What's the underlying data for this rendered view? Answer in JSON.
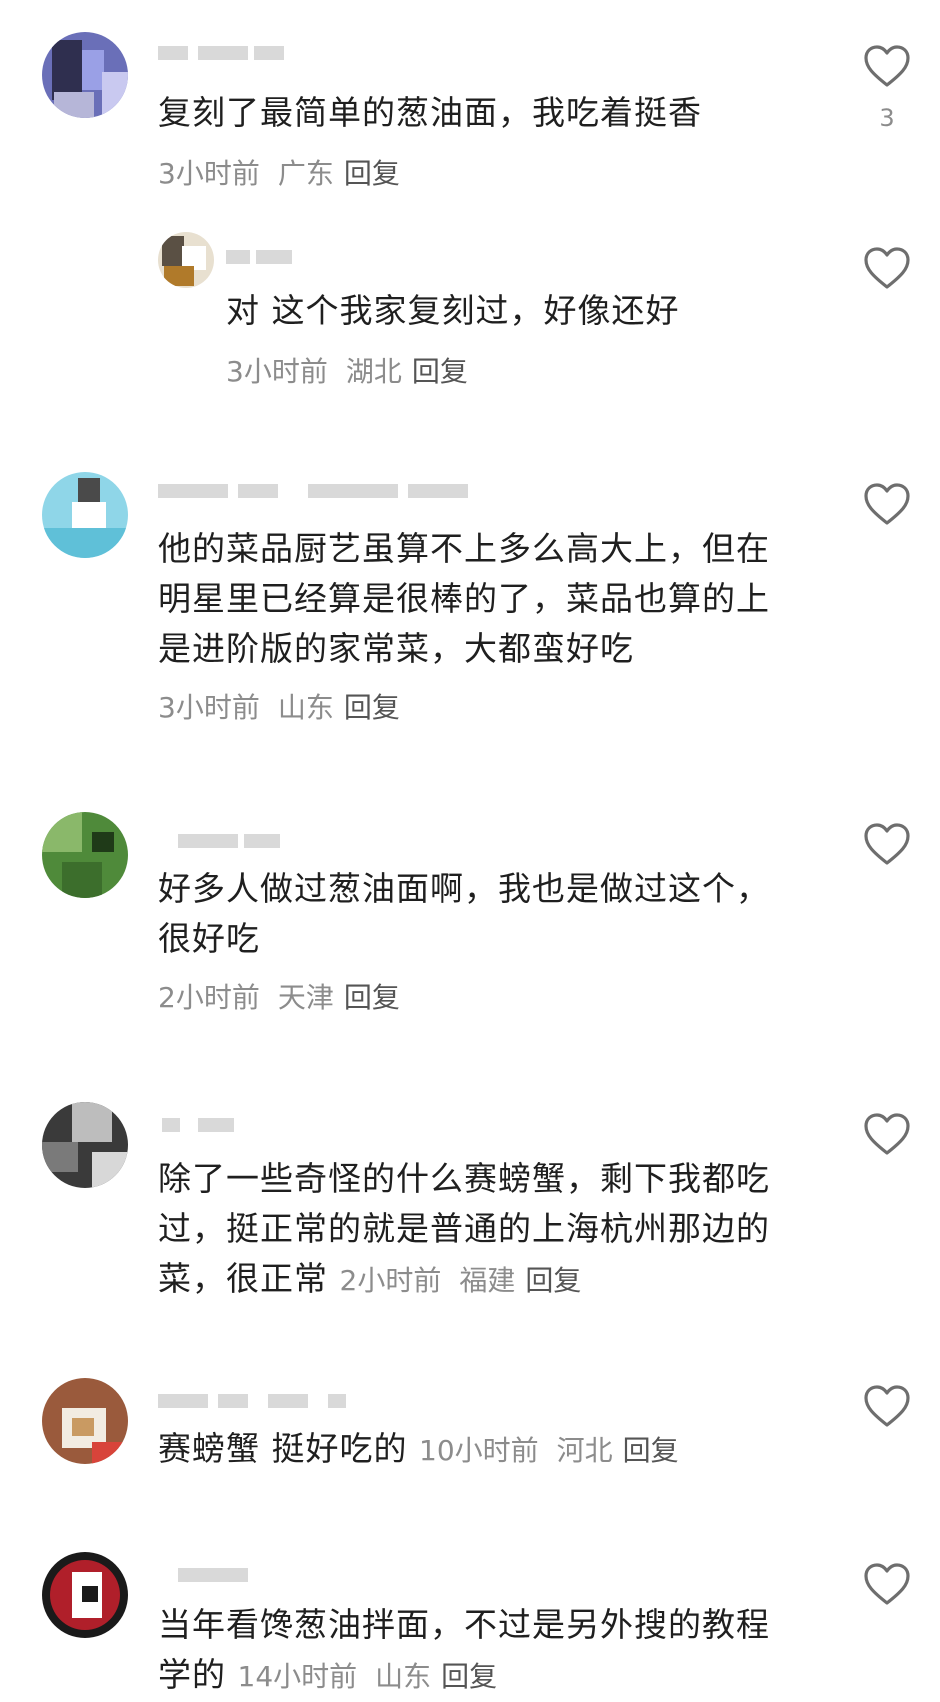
{
  "comments": [
    {
      "text": "复刻了最简单的葱油面，我吃着挺香",
      "time": "3小时前",
      "location": "广东",
      "reply": "回复",
      "likes": "3"
    },
    {
      "text": "对 这个我家复刻过，好像还好",
      "time": "3小时前",
      "location": "湖北",
      "reply": "回复"
    },
    {
      "text": "他的菜品厨艺虽算不上多么高大上，但在明星里已经算是很棒的了，菜品也算的上是进阶版的家常菜，大都蛮好吃",
      "time": "3小时前",
      "location": "山东",
      "reply": "回复"
    },
    {
      "text": "好多人做过葱油面啊，我也是做过这个，很好吃",
      "time": "2小时前",
      "location": "天津",
      "reply": "回复"
    },
    {
      "text": "除了一些奇怪的什么赛螃蟹，剩下我都吃过，挺正常的就是普通的上海杭州那边的菜，很正常",
      "time": "2小时前",
      "location": "福建",
      "reply": "回复"
    },
    {
      "text": "赛螃蟹 挺好吃的",
      "time": "10小时前",
      "location": "河北",
      "reply": "回复"
    },
    {
      "text": "当年看馋葱油拌面，不过是另外搜的教程学的",
      "time": "14小时前",
      "location": "山东",
      "reply": "回复"
    }
  ],
  "icons": {
    "like": "heart-outline-icon"
  },
  "colors": {
    "text": "#1f1f1f",
    "meta": "#8c8c8c",
    "reply": "#555555",
    "icon": "#6e6e6e"
  }
}
